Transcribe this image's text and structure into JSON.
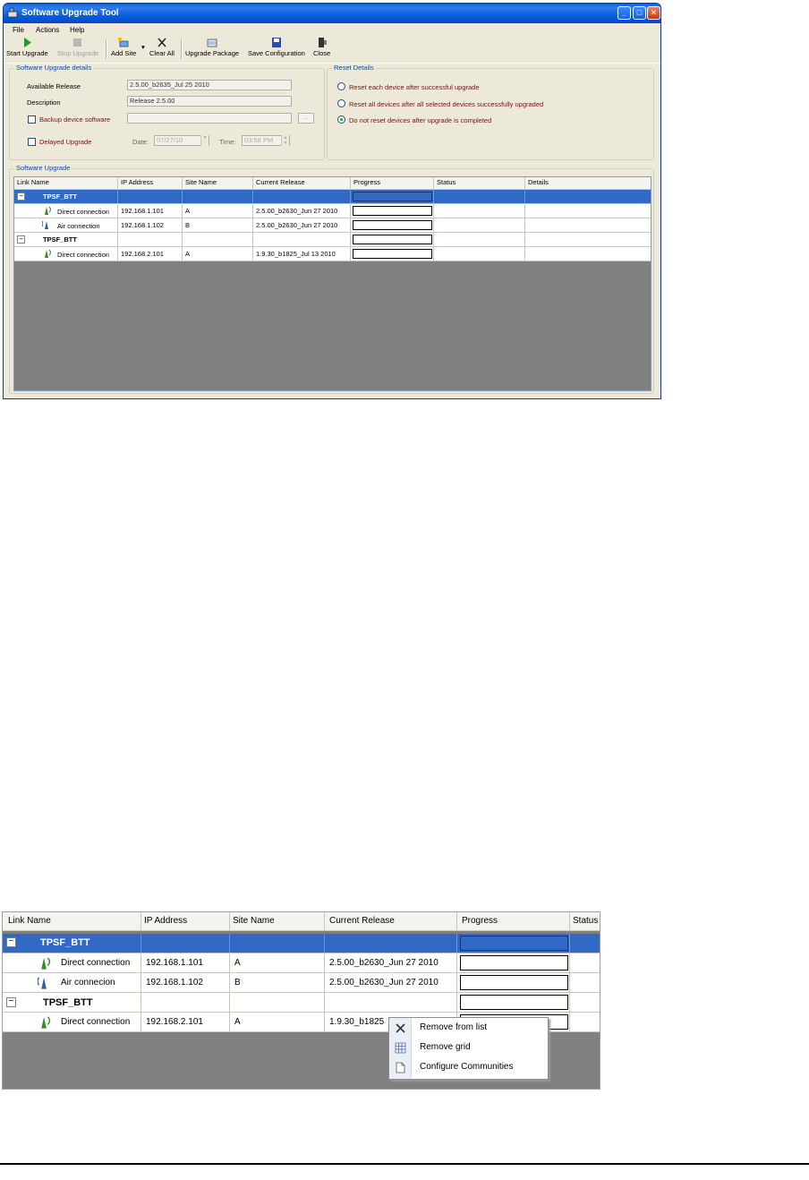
{
  "window": {
    "title": "Software Upgrade Tool",
    "menu": [
      "File",
      "Actions",
      "Help"
    ],
    "toolbar": {
      "start_upgrade": "Start Upgrade",
      "stop_upgrade": "Stop Upgrade",
      "add_site": "Add Site",
      "clear_all": "Clear All",
      "upgrade_package": "Upgrade Package",
      "save_configuration": "Save Configuration",
      "close": "Close"
    },
    "details": {
      "group_label": "Software Upgrade details",
      "available_release_label": "Available Release",
      "available_release_value": "2.5.00_b2635_Jul 25 2010",
      "description_label": "Description",
      "description_value": "Release 2.5.00",
      "backup_label": "Backup device software",
      "delayed_label": "Delayed Upgrade",
      "date_label": "Date:",
      "date_value": "07/27/10",
      "time_label": "Time:",
      "time_value": "03:58 PM",
      "browse_label": "..."
    },
    "reset": {
      "group_label": "Reset Details",
      "options": [
        "Reset each device after successful upgrade",
        "Reset all devices after all selected devices successfully upgraded",
        "Do not reset devices after upgrade is completed"
      ],
      "selected_index": 2
    },
    "upgrade": {
      "group_label": "Software Upgrade",
      "columns": [
        "Link Name",
        "IP Address",
        "Site Name",
        "Current Release",
        "Progress",
        "Status",
        "Details"
      ],
      "rows": [
        {
          "type": "group",
          "link": "TPSF_BTT",
          "ip": "",
          "site": "",
          "release": "",
          "selected": true,
          "expander": "−"
        },
        {
          "type": "child",
          "link": "Direct connection",
          "ip": "192.168.1.101",
          "site": "A",
          "release": "2.5.00_b2630_Jun 27 2010",
          "icon": "direct-connection-icon"
        },
        {
          "type": "child",
          "link": "Air connection",
          "ip": "192.168.1.102",
          "site": "B",
          "release": "2.5.00_b2630_Jun 27 2010",
          "icon": "air-connection-icon"
        },
        {
          "type": "group",
          "link": "TPSF_BTT",
          "ip": "",
          "site": "",
          "release": "",
          "selected": false,
          "expander": "−"
        },
        {
          "type": "child",
          "link": "Direct connection",
          "ip": "192.168.2.101",
          "site": "A",
          "release": "1.9.30_b1825_Jul 13 2010",
          "icon": "direct-connection-icon"
        }
      ]
    }
  },
  "zoom": {
    "columns": [
      "Link Name",
      "IP Address",
      "Site Name",
      "Current Release",
      "Progress",
      "Status"
    ],
    "rows": [
      {
        "type": "group",
        "link": "TPSF_BTT",
        "ip": "",
        "site": "",
        "release": "",
        "selected": true,
        "expander": "−"
      },
      {
        "type": "child",
        "link": "Direct connection",
        "ip": "192.168.1.101",
        "site": "A",
        "release": "2.5.00_b2630_Jun 27 2010"
      },
      {
        "type": "child",
        "link": "Air connecion",
        "ip": "192.168.1.102",
        "site": "B",
        "release": "2.5.00_b2630_Jun 27 2010"
      },
      {
        "type": "group",
        "link": "TPSF_BTT",
        "ip": "",
        "site": "",
        "release": "",
        "selected": false,
        "expander": "−"
      },
      {
        "type": "child",
        "link": "Direct connection",
        "ip": "192.168.2.101",
        "site": "A",
        "release": "1.9.30_b1825"
      }
    ],
    "context_menu": [
      "Remove from list",
      "Remove grid",
      "Configure Communities"
    ]
  },
  "colors": {
    "selection": "#316ac5",
    "title_bar": "#0a5fdc",
    "window_bg": "#ece9d8",
    "grid_empty": "#808080",
    "group_label": "#0046d5",
    "radio_label": "#7a1010"
  }
}
